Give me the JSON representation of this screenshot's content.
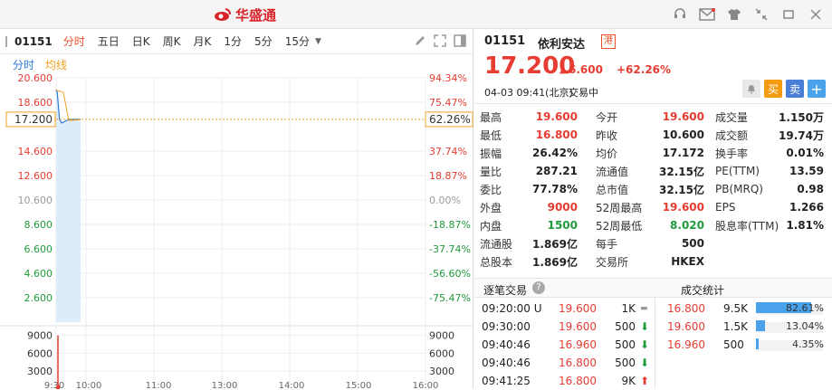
{
  "app": {
    "logo_text": "华盛通"
  },
  "toolbar": {
    "code": "01151",
    "tabs": [
      "分时",
      "五日",
      "日K",
      "周K",
      "月K",
      "1分",
      "5分",
      "15分"
    ]
  },
  "chart": {
    "legend_left": "分时",
    "legend_right": "均线",
    "current_price_label": "17.200",
    "current_pct_label": "62.26%"
  },
  "chart_data": {
    "type": "line",
    "price_ticks": [
      "20.600",
      "18.600",
      "17.200",
      "14.600",
      "12.600",
      "10.600",
      "8.600",
      "6.600",
      "4.600",
      "2.600"
    ],
    "pct_ticks": [
      "94.34%",
      "75.47%",
      "62.26%",
      "37.74%",
      "18.87%",
      "0.00%",
      "-18.87%",
      "-37.74%",
      "-56.60%",
      "-75.47%"
    ],
    "volume_ticks_left": [
      "9000",
      "6000",
      "3000"
    ],
    "volume_ticks_right": [
      "9000",
      "6000",
      "3000"
    ],
    "x_ticks": [
      "9:30",
      "10:00",
      "11:00",
      "13:00",
      "14:00",
      "15:00",
      "16:00"
    ],
    "ylim": [
      0.6,
      20.6
    ],
    "ref_price": 10.6,
    "price_series": [
      {
        "t": "09:20",
        "v": 19.6
      },
      {
        "t": "09:30",
        "v": 19.6
      },
      {
        "t": "09:31",
        "v": 19.4
      },
      {
        "t": "09:33",
        "v": 17.2
      },
      {
        "t": "09:35",
        "v": 16.9
      },
      {
        "t": "09:37",
        "v": 17.0
      },
      {
        "t": "09:41",
        "v": 17.2
      }
    ],
    "volumes": [
      {
        "t": "09:30",
        "v": 500
      },
      {
        "t": "09:31",
        "v": 9000
      },
      {
        "t": "09:32",
        "v": 700
      }
    ]
  },
  "stock": {
    "code": "01151",
    "name": "依利安达",
    "tag": "港",
    "price": "17.200",
    "change": "6.600",
    "change_pct": "+62.26%",
    "time": "04-03  09:41(北京)",
    "status": "交易中",
    "buy_label": "买",
    "sell_label": "卖",
    "add_label": "+"
  },
  "stats": [
    {
      "k": "最高",
      "v": "19.600",
      "c": "red"
    },
    {
      "k": "今开",
      "v": "19.600",
      "c": "red"
    },
    {
      "k": "成交量",
      "v": "1.150万",
      "c": ""
    },
    {
      "k": "最低",
      "v": "16.800",
      "c": "red"
    },
    {
      "k": "昨收",
      "v": "10.600",
      "c": ""
    },
    {
      "k": "成交额",
      "v": "19.74万",
      "c": ""
    },
    {
      "k": "振幅",
      "v": "26.42%",
      "c": ""
    },
    {
      "k": "均价",
      "v": "17.172",
      "c": ""
    },
    {
      "k": "换手率",
      "v": "0.01%",
      "c": ""
    },
    {
      "k": "量比",
      "v": "287.21",
      "c": ""
    },
    {
      "k": "流通值",
      "v": "32.15亿",
      "c": ""
    },
    {
      "k": "PE(TTM)",
      "v": "13.59",
      "c": ""
    },
    {
      "k": "委比",
      "v": "77.78%",
      "c": ""
    },
    {
      "k": "总市值",
      "v": "32.15亿",
      "c": ""
    },
    {
      "k": "PB(MRQ)",
      "v": "0.98",
      "c": ""
    },
    {
      "k": "外盘",
      "v": "9000",
      "c": "red"
    },
    {
      "k": "52周最高",
      "v": "19.600",
      "c": "red"
    },
    {
      "k": "EPS",
      "v": "1.266",
      "c": ""
    },
    {
      "k": "内盘",
      "v": "1500",
      "c": "green"
    },
    {
      "k": "52周最低",
      "v": "8.020",
      "c": "green"
    },
    {
      "k": "股息率(TTM)",
      "v": "1.81%",
      "c": ""
    },
    {
      "k": "流通股",
      "v": "1.869亿",
      "c": ""
    },
    {
      "k": "每手",
      "v": "500",
      "c": ""
    },
    {
      "k": "",
      "v": "",
      "c": ""
    },
    {
      "k": "总股本",
      "v": "1.869亿",
      "c": ""
    },
    {
      "k": "交易所",
      "v": "HKEX",
      "c": ""
    },
    {
      "k": "",
      "v": "",
      "c": ""
    }
  ],
  "trades_head": {
    "left": "逐笔交易",
    "right": "成交统计"
  },
  "trades": [
    {
      "time": "09:20:00 U",
      "price": "19.600",
      "vol": "1K",
      "dir": "flat"
    },
    {
      "time": "09:30:00",
      "price": "19.600",
      "vol": "500",
      "dir": "down"
    },
    {
      "time": "09:40:46",
      "price": "16.960",
      "vol": "500",
      "dir": "down"
    },
    {
      "time": "09:40:46",
      "price": "16.800",
      "vol": "500",
      "dir": "down"
    },
    {
      "time": "09:41:25",
      "price": "16.800",
      "vol": "9K",
      "dir": "up"
    }
  ],
  "vol_stats": [
    {
      "price": "16.800",
      "vol": "9.5K",
      "pct": "82.61%",
      "frac": 0.8261
    },
    {
      "price": "19.600",
      "vol": "1.5K",
      "pct": "13.04%",
      "frac": 0.1304
    },
    {
      "price": "16.960",
      "vol": "500",
      "pct": "4.35%",
      "frac": 0.0435
    }
  ]
}
